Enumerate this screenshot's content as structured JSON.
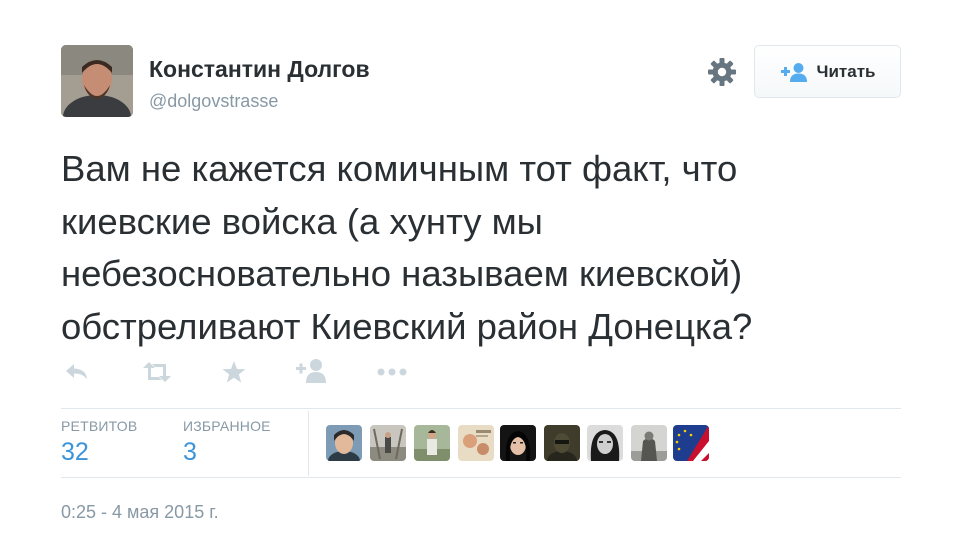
{
  "author": {
    "name": "Константин Долгов",
    "handle": "@dolgovstrasse"
  },
  "follow_button": {
    "label": "Читать"
  },
  "tweet": {
    "text": "Вам не кажется комичным тот факт, что\nкиевские войска (а хунту мы\nнебезосновательно называем киевской)\nобстреливают Киевский район Донецка?"
  },
  "actions": [
    "reply-icon",
    "retweet-icon",
    "favorite-icon",
    "follow-icon",
    "more-icon"
  ],
  "stats": {
    "retweets": {
      "label": "РЕТВИТОВ",
      "value": "32"
    },
    "favorites": {
      "label": "ИЗБРАННОЕ",
      "value": "3"
    }
  },
  "favoriters": [
    {
      "name": "user-avatar-1"
    },
    {
      "name": "user-avatar-2"
    },
    {
      "name": "user-avatar-3"
    },
    {
      "name": "user-avatar-4"
    },
    {
      "name": "user-avatar-5"
    },
    {
      "name": "user-avatar-6"
    },
    {
      "name": "user-avatar-7"
    },
    {
      "name": "user-avatar-8"
    },
    {
      "name": "user-avatar-9"
    }
  ],
  "timestamp": "0:25 - 4 мая 2015 г.",
  "colors": {
    "text": "#292f33",
    "muted": "#8899a6",
    "link": "#3b94d9",
    "follow_icon": "#55acee",
    "action_icon": "#ccd6dd",
    "divider": "#e1e8ed"
  }
}
